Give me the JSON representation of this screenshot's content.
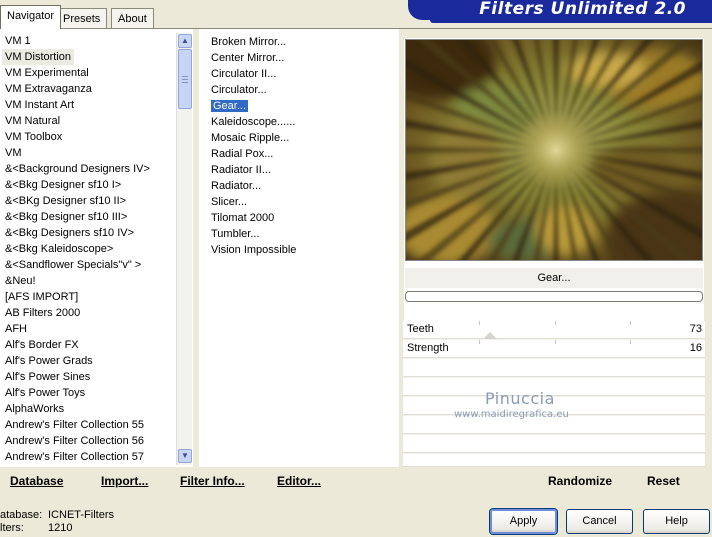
{
  "tabs": [
    {
      "label": "Navigator",
      "active": true
    },
    {
      "label": "Presets",
      "active": false
    },
    {
      "label": "About",
      "active": false
    }
  ],
  "app_title": "Filters Unlimited 2.0",
  "categories": [
    "VM 1",
    "VM Distortion",
    "VM Experimental",
    "VM Extravaganza",
    "VM Instant Art",
    "VM Natural",
    "VM Toolbox",
    "VM",
    "&<Background Designers IV>",
    "&<Bkg Designer sf10 I>",
    "&<BKg Designer sf10 II>",
    "&<Bkg Designer sf10 III>",
    "&<Bkg Designers sf10 IV>",
    "&<Bkg Kaleidoscope>",
    "&<Sandflower Specials\"v\" >",
    "&Neu!",
    "[AFS IMPORT]",
    "AB Filters 2000",
    "AFH",
    "Alf's Border FX",
    "Alf's Power Grads",
    "Alf's Power Sines",
    "Alf's Power Toys",
    "AlphaWorks",
    "Andrew's Filter Collection 55",
    "Andrew's Filter Collection 56",
    "Andrew's Filter Collection 57"
  ],
  "selected_category": "VM Distortion",
  "filters": [
    "Broken Mirror...",
    "Center Mirror...",
    "Circulator II...",
    "Circulator...",
    "Gear...",
    "Kaleidoscope......",
    "Mosaic Ripple...",
    "Radial Pox...",
    "Radiator II...",
    "Radiator...",
    "Slicer...",
    "Tilomat 2000",
    "Tumbler...",
    "Vision Impossible"
  ],
  "selected_filter": "Gear...",
  "filter_name": "Gear...",
  "progress": 0,
  "sliders": [
    {
      "label": "Teeth",
      "value": "73"
    },
    {
      "label": "Strength",
      "value": "16"
    }
  ],
  "watermark": {
    "name": "Pinuccia",
    "url": "www.maidiregrafica.eu"
  },
  "bottom_links": {
    "database": "Database",
    "import": "Import...",
    "filter_info": "Filter Info...",
    "editor": "Editor...",
    "randomize": "Randomize",
    "reset": "Reset"
  },
  "info": {
    "database_label": "atabase:",
    "database_value": "ICNET-Filters",
    "filters_label": "lters:",
    "filters_value": "1210"
  },
  "buttons": {
    "apply": "Apply",
    "cancel": "Cancel",
    "help": "Help"
  },
  "colors": {
    "selection": "#316ac5",
    "banner": "#1a2a9c"
  },
  "icons": {
    "scroll_up": "▲",
    "scroll_down": "▼"
  }
}
